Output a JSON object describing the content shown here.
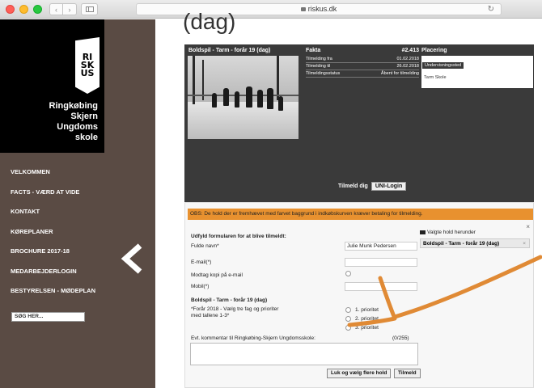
{
  "browser": {
    "url": "riskus.dk"
  },
  "sidebar": {
    "logo_lines": [
      "Ringkøbing",
      "Skjern",
      "Ungdoms",
      "skole"
    ],
    "emblem_text": "RI SK US",
    "nav": [
      "VELKOMMEN",
      "FACTS - VÆRD AT VIDE",
      "KONTAKT",
      "KØREPLANER",
      "BROCHURE 2017-18",
      "MEDARBEJDERLOGIN",
      "BESTYRELSEN - MØDEPLAN"
    ],
    "search_placeholder": "SØG HER..."
  },
  "main": {
    "heading": "(dag)",
    "event_title": "Boldspil - Tarm - forår 19 (dag)",
    "fakta": {
      "label": "Fakta",
      "number": "#2.413",
      "rows": [
        {
          "k": "Tilmelding fra",
          "v": "01.02.2018"
        },
        {
          "k": "Tilmelding til",
          "v": "26.02.2018"
        },
        {
          "k": "Tilmeldingsstatus",
          "v": "Åbent for tilmelding"
        }
      ]
    },
    "placering": {
      "label": "Placering",
      "tab": "Undervisningssted",
      "place": "Tarm Skole"
    },
    "tilmeld_label": "Tilmeld dig",
    "uni_login": "UNI-Login"
  },
  "form": {
    "notice": "OBS: De hold der er fremhævet med farvet baggrund i indkøbskurven kræver betaling for tilmelding.",
    "close": "×",
    "section_title": "Udfyld formularen for at blive tilmeldt:",
    "name_label": "Fulde navn*",
    "name_value": "Julie Munk Pedersen",
    "email_label": "E-mail(*)",
    "copy_label": "Modtag kopi på e-mail",
    "mobile_label": "Mobil(*)",
    "course_title": "Boldspil - Tarm - forår 19 (dag)",
    "priority_prompt_1": "*Forår 2018 - Vælg tre fag og prioriter",
    "priority_prompt_2": "med tallene 1-3*",
    "priorities": [
      "1. prioritet",
      "2. prioritet",
      "3. prioritet"
    ],
    "chosen_heading": "Valgte hold herunder",
    "chosen_item": "Boldspil - Tarm - forår 19 (dag)",
    "chosen_remove": "×",
    "comment_label": "Evt. kommentar til Ringkøbing-Skjern Ungdomsskole:",
    "comment_count": "(0/255)",
    "btn_close_more": "Luk og vælg flere hold",
    "btn_tilmeld": "Tilmeld"
  },
  "colors": {
    "sidebar": "#5a4b44",
    "notice": "#e8912f",
    "arrow": "#e08a35"
  }
}
